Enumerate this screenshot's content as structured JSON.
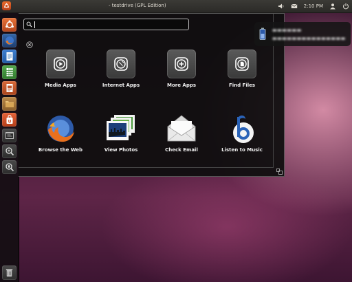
{
  "panel": {
    "window_title": "- testdrive (GPL Edition)",
    "clock": "2:10 PM",
    "tray_icons": [
      "volume-icon",
      "mail-icon",
      "user-icon",
      "power-icon"
    ]
  },
  "launcher": {
    "items": [
      {
        "name": "ubuntu-dash",
        "icon": "ubuntu-icon",
        "color": "#e06a2b"
      },
      {
        "name": "firefox",
        "icon": "firefox-icon",
        "color": "#2a4e8c"
      },
      {
        "name": "writer",
        "icon": "document-icon",
        "color": "#2e6db5"
      },
      {
        "name": "calc",
        "icon": "spreadsheet-icon",
        "color": "#3d8f3a"
      },
      {
        "name": "impress",
        "icon": "presentation-icon",
        "color": "#c4562a"
      },
      {
        "name": "files",
        "icon": "folder-icon",
        "color": "#a3713a"
      },
      {
        "name": "software-center",
        "icon": "shopping-bag-icon",
        "color": "#d8522b"
      },
      {
        "name": "workspaces",
        "icon": "workspace-icon",
        "color": "#3b3b3b"
      },
      {
        "name": "apps-lens",
        "icon": "apps-lens-icon",
        "color": "#3b3b3b"
      },
      {
        "name": "files-lens",
        "icon": "files-lens-icon",
        "color": "#3b3b3b"
      }
    ]
  },
  "dash": {
    "search": {
      "value": "",
      "placeholder": ""
    },
    "tiles": [
      {
        "label": "Media Apps",
        "icon": "media-play-icon"
      },
      {
        "label": "Internet Apps",
        "icon": "globe-icon"
      },
      {
        "label": "More Apps",
        "icon": "plus-icon"
      },
      {
        "label": "Find Files",
        "icon": "find-files-icon"
      },
      {
        "label": "Browse the Web",
        "icon": "firefox-icon"
      },
      {
        "label": "View Photos",
        "icon": "photos-icon"
      },
      {
        "label": "Check Email",
        "icon": "email-icon"
      },
      {
        "label": "Listen to Music",
        "icon": "music-icon"
      }
    ]
  },
  "notification": {
    "title": "▬▬▬▬▬▬",
    "body": "▬▬▬▬▬▬▬▬▬▬▬▬▬▬▬"
  },
  "colors": {
    "panel": "#2f2e2b",
    "ubuntu_orange": "#e06a2b",
    "dash_bg": "#0e0e0e"
  }
}
